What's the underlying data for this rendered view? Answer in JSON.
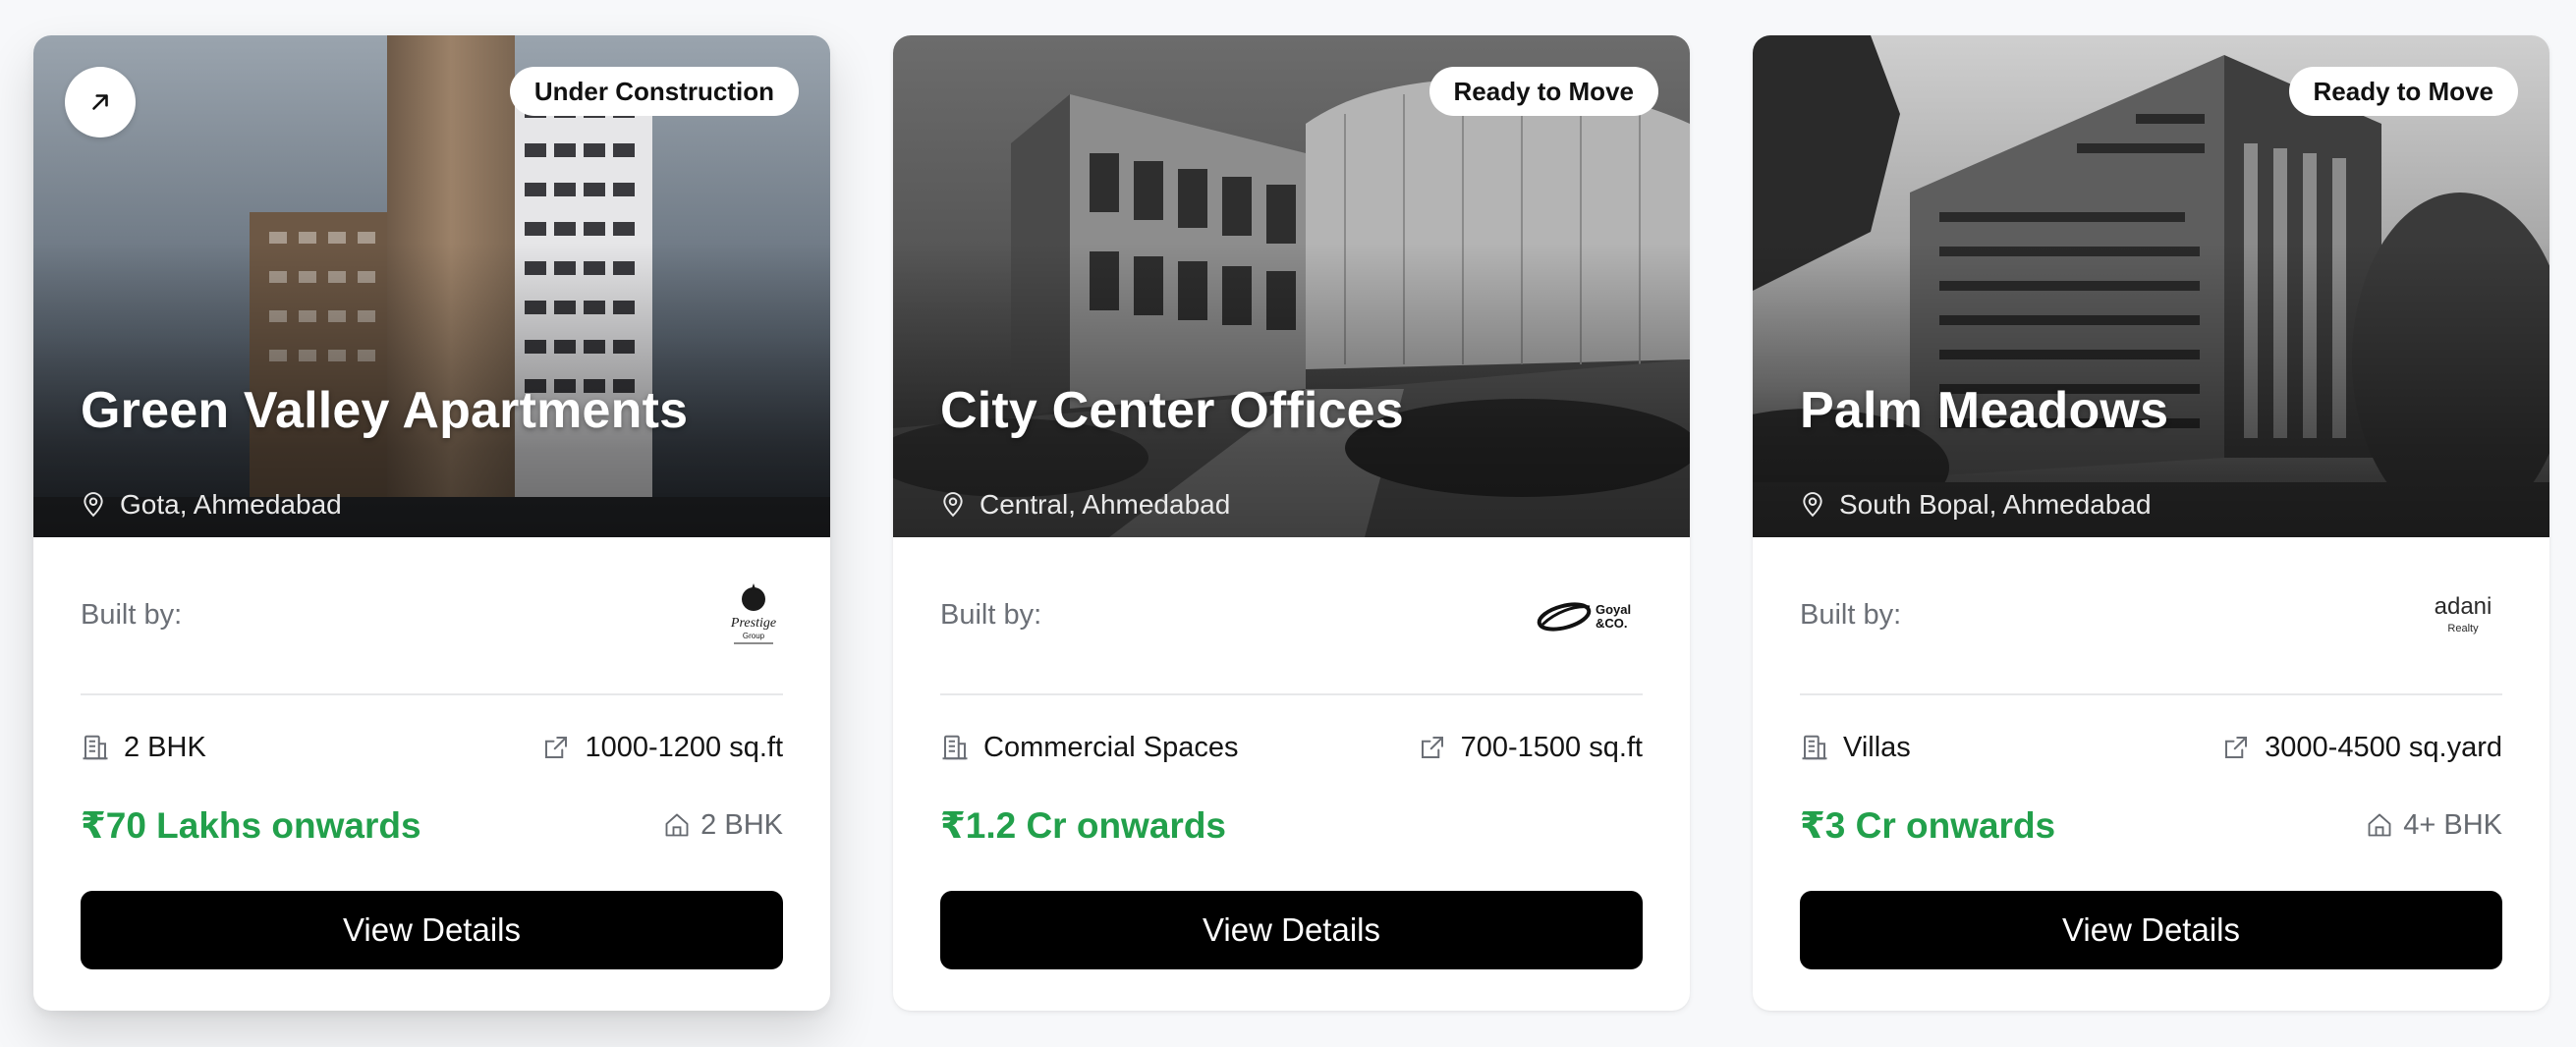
{
  "cards": [
    {
      "status": "Under Construction",
      "title": "Green Valley Apartments",
      "location": "Gota, Ahmedabad",
      "built_by_label": "Built by:",
      "builder_logo": "prestige-group-logo",
      "property_type": "2 BHK",
      "area": "1000-1200 sq.ft",
      "price": "₹70 Lakhs onwards",
      "configuration": "2 BHK",
      "button": "View Details"
    },
    {
      "status": "Ready to Move",
      "title": "City Center Offices",
      "location": "Central, Ahmedabad",
      "built_by_label": "Built by:",
      "builder_logo": "goyal-and-co-logo",
      "property_type": "Commercial Spaces",
      "area": "700-1500 sq.ft",
      "price": "₹1.2 Cr onwards",
      "configuration": "",
      "button": "View Details"
    },
    {
      "status": "Ready to Move",
      "title": "Palm Meadows",
      "location": "South Bopal, Ahmedabad",
      "built_by_label": "Built by:",
      "builder_logo": "adani-realty-logo",
      "property_type": "Villas",
      "area": "3000-4500 sq.yard",
      "price": "₹3 Cr onwards",
      "configuration": "4+ BHK",
      "button": "View Details"
    }
  ],
  "logos": {
    "prestige": {
      "line1": "Prestige",
      "line2": "Group"
    },
    "goyal": {
      "line1": "Goyal",
      "line2": "&CO."
    },
    "adani": {
      "line1": "adani",
      "line2": "Realty"
    }
  },
  "colors": {
    "price": "#22a04b",
    "button_bg": "#000000",
    "badge_bg": "#ffffff",
    "page_bg": "#f7f8fa"
  }
}
